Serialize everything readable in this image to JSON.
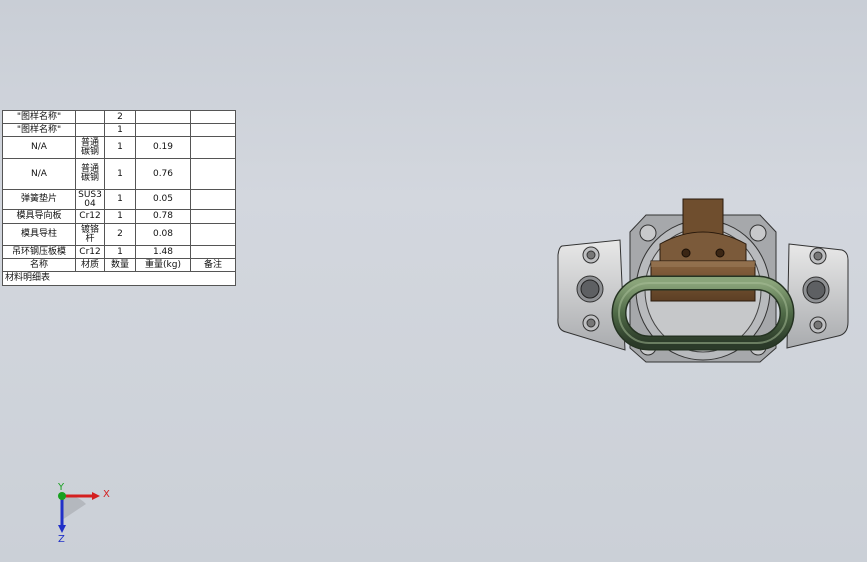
{
  "bom": {
    "rows": [
      {
        "name": "\"图样名称\"",
        "material": "",
        "qty": "2",
        "weight": "",
        "note": "",
        "h": 13
      },
      {
        "name": "\"图样名称\"",
        "material": "",
        "qty": "1",
        "weight": "",
        "note": "",
        "h": 13
      },
      {
        "name": "N/A",
        "material": "普通碳钢",
        "qty": "1",
        "weight": "0.19",
        "note": "",
        "h": 22
      },
      {
        "name": "N/A",
        "material": "普通碳钢",
        "qty": "1",
        "weight": "0.76",
        "note": "",
        "h": 31
      },
      {
        "name": "弹簧垫片",
        "material": "SUS304",
        "qty": "1",
        "weight": "0.05",
        "note": "",
        "h": 20
      },
      {
        "name": "模具导向板",
        "material": "Cr12",
        "qty": "1",
        "weight": "0.78",
        "note": "",
        "h": 14
      },
      {
        "name": "模具导柱",
        "material": "镀铬杆",
        "qty": "2",
        "weight": "0.08",
        "note": "",
        "h": 22
      },
      {
        "name": "吊环钢压板模",
        "material": "Cr12",
        "qty": "1",
        "weight": "1.48",
        "note": "",
        "h": 13
      }
    ],
    "header": {
      "name": "名称",
      "material": "材质",
      "qty": "数量",
      "weight": "重量(kg)",
      "note": "备注"
    },
    "caption": "材料明细表"
  },
  "triad": {
    "x_label": "X",
    "y_label": "Y",
    "z_label": "Z"
  },
  "colors": {
    "x_axis": "#d42020",
    "y_axis": "#18a020",
    "z_axis": "#2030c8",
    "brown_part": "#7a5634",
    "ring": "#4f6a47"
  }
}
